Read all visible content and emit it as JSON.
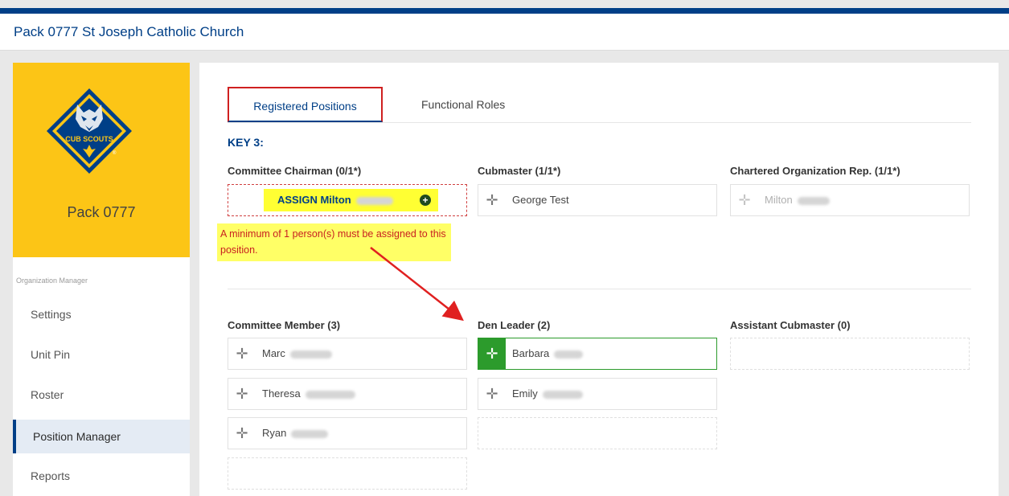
{
  "header": {
    "title": "Pack 0777 St Joseph Catholic Church"
  },
  "sidebar": {
    "brand_name": "Pack 0777",
    "logo_text": "CUB SCOUTS",
    "section_label": "Organization Manager",
    "items": [
      {
        "label": "Settings"
      },
      {
        "label": "Unit Pin"
      },
      {
        "label": "Roster"
      },
      {
        "label": "Position Manager"
      },
      {
        "label": "Reports"
      }
    ]
  },
  "tabs": [
    {
      "label": "Registered Positions"
    },
    {
      "label": "Functional Roles"
    }
  ],
  "key3": {
    "label": "KEY 3:",
    "committee_chairman": {
      "label": "Committee Chairman (0/1*)",
      "assign_label": "ASSIGN Milton",
      "warning": "A minimum of 1 person(s) must be assigned to this position."
    },
    "cubmaster": {
      "label": "Cubmaster (1/1*)",
      "member": "George Test"
    },
    "chartered_rep": {
      "label": "Chartered Organization Rep. (1/1*)",
      "member": "Milton"
    }
  },
  "positions": {
    "committee_member": {
      "label": "Committee Member (3)",
      "members": [
        "Marc",
        "Theresa",
        "Ryan"
      ]
    },
    "den_leader": {
      "label": "Den Leader (2)",
      "members": [
        "Barbara",
        "Emily"
      ]
    },
    "assistant_cubmaster": {
      "label": "Assistant Cubmaster (0)"
    }
  },
  "colors": {
    "brand_blue": "#003f87",
    "scout_yellow": "#fcc516",
    "highlight": "#ffff33",
    "error_red": "#cf2020",
    "assigned_green": "#2c9b2c"
  },
  "icons": [
    "move-handle-icon",
    "add-circle-icon",
    "cub-scouts-logo"
  ]
}
